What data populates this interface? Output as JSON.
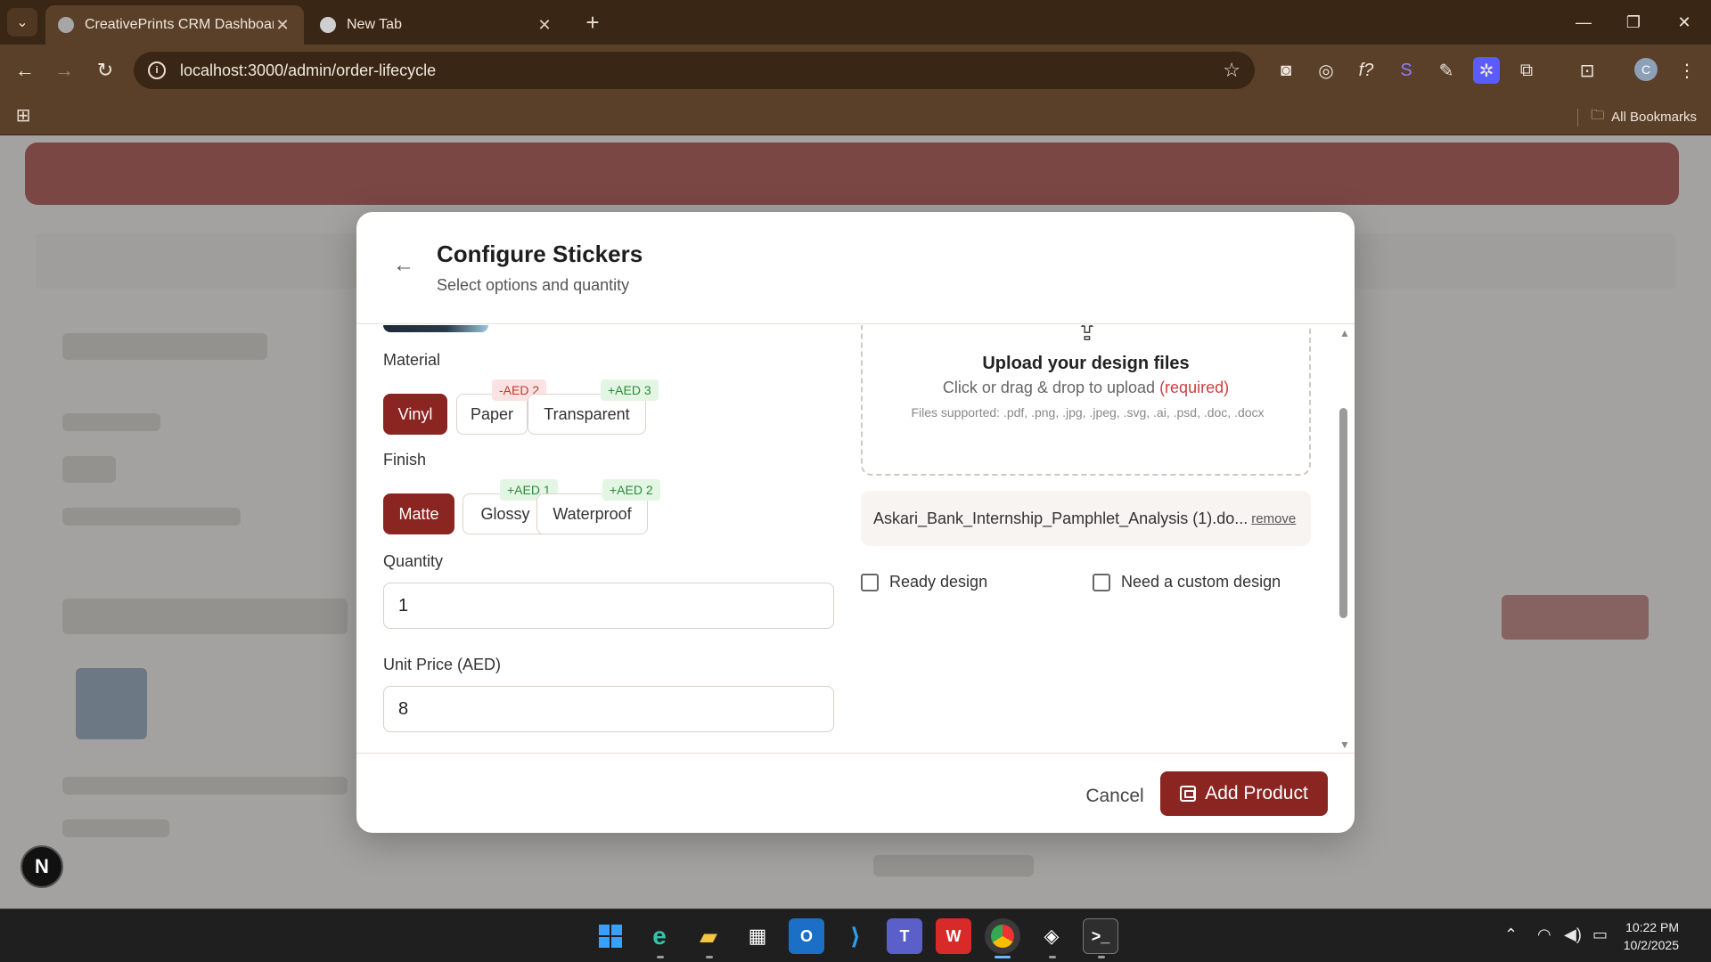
{
  "browser": {
    "tabs": [
      {
        "title": "CreativePrints CRM Dashboard",
        "close": "✕"
      },
      {
        "title": "New Tab",
        "close": "✕"
      }
    ],
    "new_tab": "+",
    "url": "localhost:3000/admin/order-lifecycle",
    "bookmarks_label": "All Bookmarks",
    "profile_initial": "C"
  },
  "modal": {
    "title": "Configure Stickers",
    "subtitle": "Select options and quantity",
    "material": {
      "label": "Material",
      "options": [
        {
          "label": "Vinyl",
          "selected": true,
          "badge": ""
        },
        {
          "label": "Paper",
          "selected": false,
          "badge": "-AED 2"
        },
        {
          "label": "Transparent",
          "selected": false,
          "badge": "+AED 3"
        }
      ]
    },
    "finish": {
      "label": "Finish",
      "options": [
        {
          "label": "Matte",
          "selected": true,
          "badge": ""
        },
        {
          "label": "Glossy",
          "selected": false,
          "badge": "+AED 1"
        },
        {
          "label": "Waterproof",
          "selected": false,
          "badge": "+AED 2"
        }
      ]
    },
    "quantity": {
      "label": "Quantity",
      "value": "1"
    },
    "unit_price": {
      "label": "Unit Price (AED)",
      "value": "8"
    },
    "upload": {
      "title": "Upload your design files",
      "subtitle": "Click or drag & drop to upload",
      "required": "(required)",
      "files_supported": "Files supported: .pdf, .png, .jpg, .jpeg, .svg, .ai, .psd, .doc, .docx"
    },
    "uploaded_file": {
      "name": "Askari_Bank_Internship_Pamphlet_Analysis (1).do...",
      "remove": "remove"
    },
    "checkboxes": [
      {
        "label": "Ready design",
        "checked": false
      },
      {
        "label": "Need a custom design",
        "checked": false
      }
    ],
    "footer": {
      "cancel": "Cancel",
      "add": "Add Product"
    }
  },
  "dev_badge": "N",
  "taskbar": {
    "time": "10:22 PM",
    "date": "10/2/2025"
  },
  "colors": {
    "accent": "#8b2522",
    "badge_negative": "#c0392b",
    "badge_positive": "#2f8a3a",
    "chrome_frame": "#3a2614"
  }
}
